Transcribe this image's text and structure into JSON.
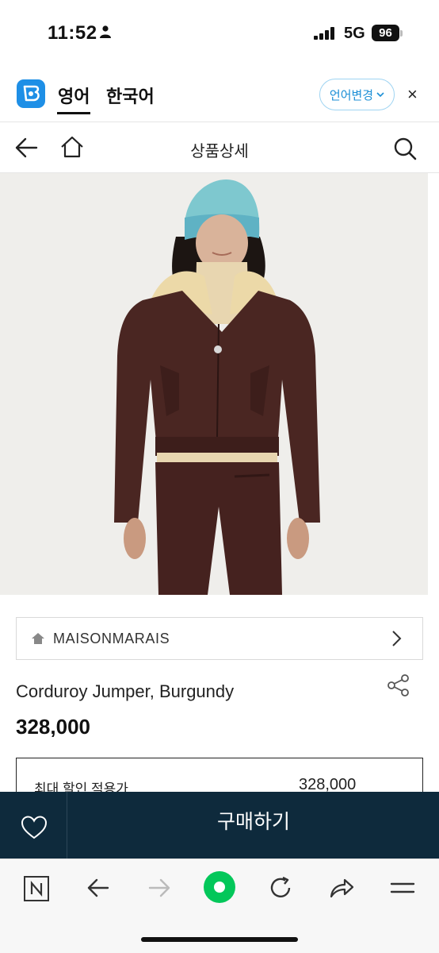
{
  "status_bar": {
    "time": "11:52",
    "network": "5G",
    "battery": "96"
  },
  "translate_bar": {
    "source_lang": "영어",
    "target_lang": "한국어",
    "change_label": "언어변경",
    "close_label": "×"
  },
  "header": {
    "title": "상품상세"
  },
  "brand": {
    "name": "MAISONMARAIS"
  },
  "product": {
    "name": "Corduroy Jumper, Burgundy",
    "price": "328,000",
    "discount_label": "최대 할인 적용가",
    "discount_price": "328,000"
  },
  "buy_bar": {
    "buy_label": "구매하기"
  },
  "colors": {
    "buy_bar_bg": "#0e2a3c",
    "accent_blue": "#1b8fd6",
    "naver_green": "#03c75a",
    "jacket_brown": "#4a2622",
    "beanie_teal": "#7ec8cf"
  },
  "icons": {
    "status": [
      "person-icon",
      "signal-icon",
      "battery-icon"
    ],
    "header": [
      "back-arrow-icon",
      "home-icon",
      "search-icon"
    ],
    "toolbar": [
      "naver-n-icon",
      "back-icon",
      "forward-icon",
      "green-dot-icon",
      "refresh-icon",
      "share-icon",
      "menu-icon"
    ]
  }
}
